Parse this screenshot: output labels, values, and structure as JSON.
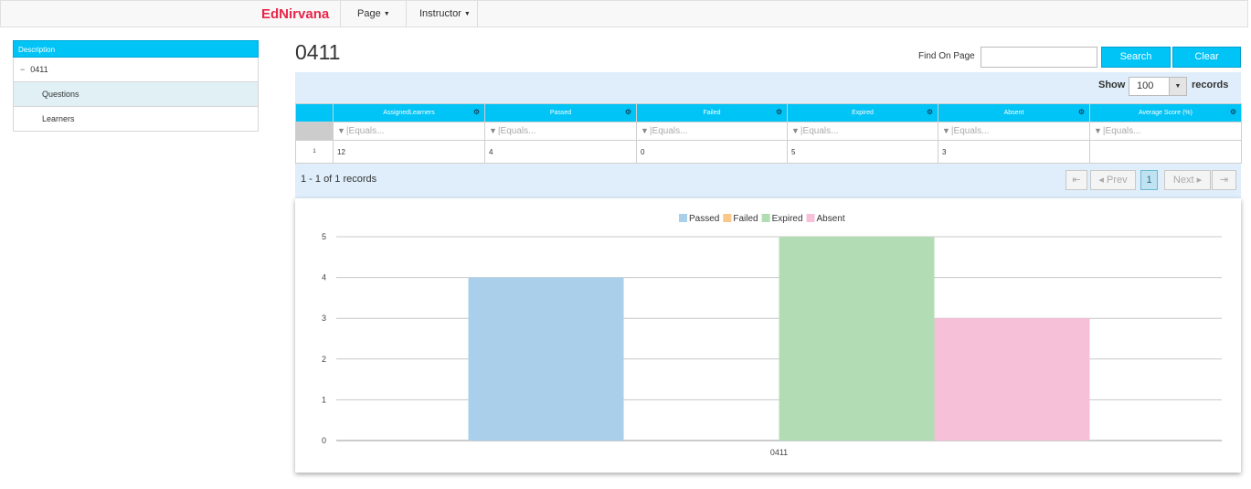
{
  "nav": {
    "brand": "EdNirvana",
    "page_label": "Page",
    "instructor_label": "Instructor"
  },
  "tree": {
    "header": "Description",
    "root": "0411",
    "children": [
      "Questions",
      "Learners"
    ],
    "selected": "Questions"
  },
  "page": {
    "title": "0411",
    "find_label": "Find On Page",
    "find_value": "",
    "search_label": "Search",
    "clear_label": "Clear"
  },
  "grid": {
    "show_label": "Show",
    "show_value": "100",
    "records_label": "records",
    "columns": [
      "AssignedLearners",
      "Passed",
      "Failed",
      "Expired",
      "Absent",
      "Average Score (%)"
    ],
    "filter_placeholder": "Equals...",
    "rows": [
      {
        "index": "1",
        "cells": [
          "12",
          "4",
          "0",
          "5",
          "3",
          ""
        ]
      }
    ],
    "records_info": "1 - 1 of 1 records",
    "pager": {
      "first": "⇤",
      "prev": "◂ Prev",
      "current": "1",
      "next": "Next ▸",
      "last": "⇥"
    }
  },
  "colors": {
    "accent": "#00c3f6",
    "brand": "#e8254a",
    "panel": "#dfeefa"
  },
  "chart_data": {
    "type": "bar",
    "categories": [
      "0411"
    ],
    "series": [
      {
        "name": "Passed",
        "values": [
          4
        ],
        "color": "#aacfeb"
      },
      {
        "name": "Failed",
        "values": [
          0
        ],
        "color": "#f9c68b"
      },
      {
        "name": "Expired",
        "values": [
          5
        ],
        "color": "#b2ddb4"
      },
      {
        "name": "Absent",
        "values": [
          3
        ],
        "color": "#f6c1d8"
      }
    ],
    "ylim": [
      0,
      5
    ],
    "yticks": [
      "0",
      "1",
      "2",
      "3",
      "4",
      "5"
    ],
    "grid": true,
    "legend": "top-center"
  }
}
